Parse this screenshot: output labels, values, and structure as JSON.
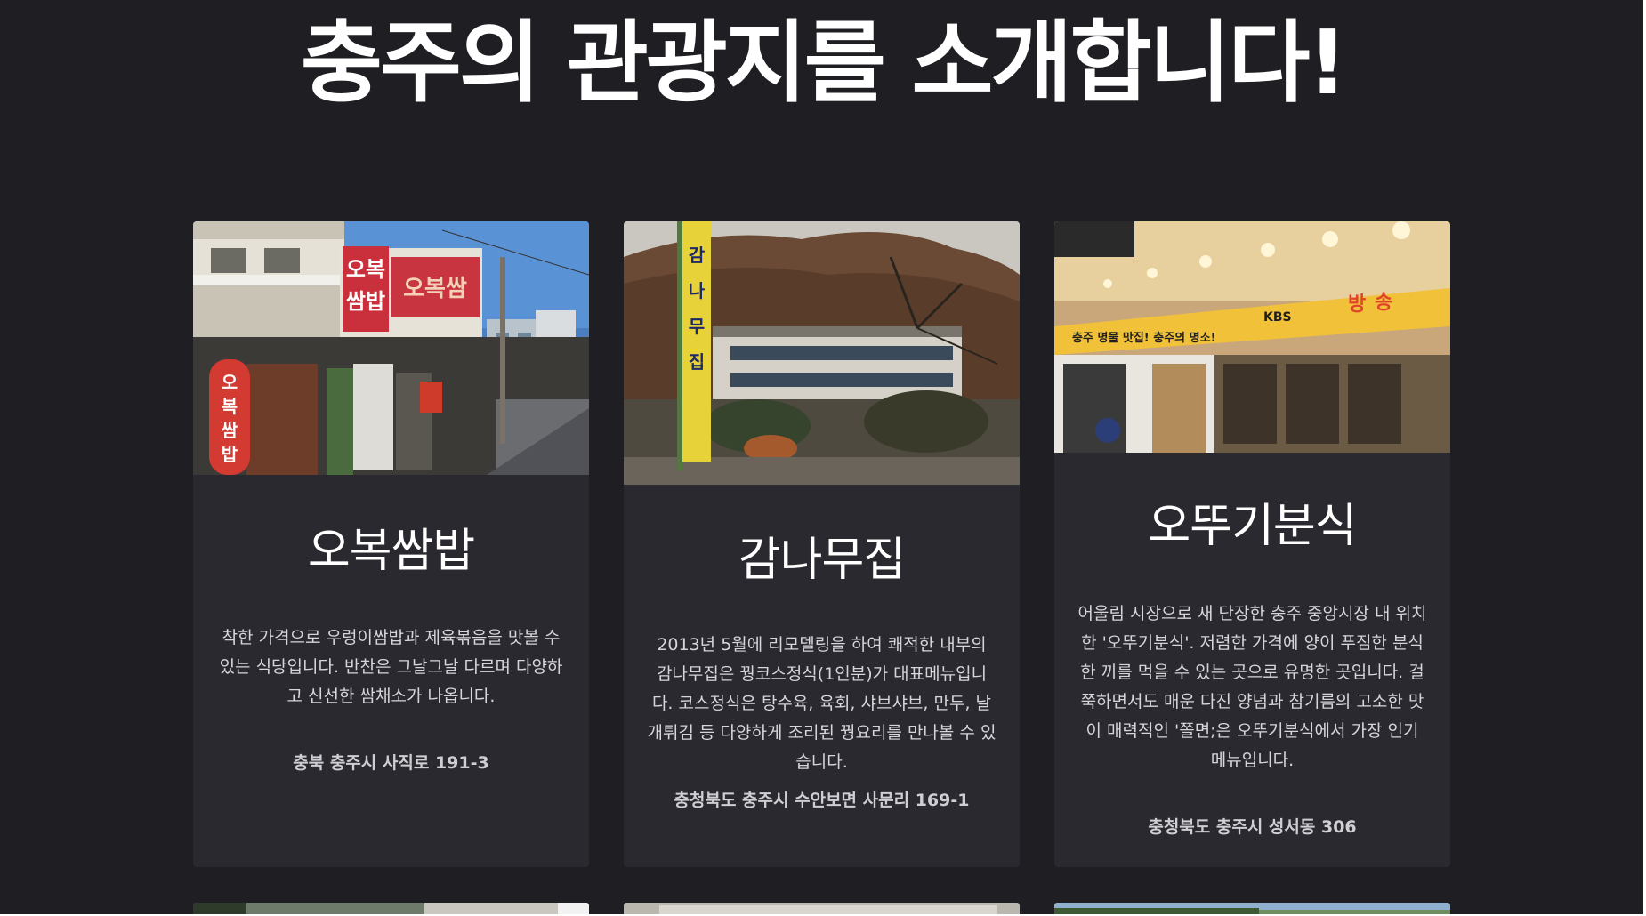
{
  "page": {
    "title": "충주의 관광지를 소개합니다!"
  },
  "cards": [
    {
      "name": "오복쌈밥",
      "description": "착한 가격으로 우렁이쌈밥과 제육볶음을 맛볼 수 있는 식당입니다. 반찬은 그날그날 다르며 다양하고 신선한 쌈채소가 나옵니다.",
      "address": "충북 충주시 사직로 191-3",
      "photo_sign": "오복쌈밥"
    },
    {
      "name": "감나무집",
      "description": "2013년 5월에 리모델링을 하여 쾌적한 내부의 감나무집은 꿩코스정식(1인분)가 대표메뉴입니다. 코스정식은 탕수육, 육회, 샤브샤브, 만두, 날개튀김 등 다양하게 조리된 꿩요리를 만나볼 수 있습니다.",
      "address": "충청북도 충주시 수안보면 사문리 169-1",
      "photo_sign": "감나무집"
    },
    {
      "name": "오뚜기분식",
      "description": "어울림 시장으로 새 단장한 충주 중앙시장 내 위치한 '오뚜기분식'. 저렴한 가격에 양이 푸짐한 분식 한 끼를 먹을 수 있는 곳으로 유명한 곳입니다. 걸쭉하면서도 매운 다진 양념과 참기름의 고소한 맛이 매력적인 '쫄면;은 오뚜기분식에서 가장 인기 메뉴입니다.",
      "address": "충청북도 충주시 성서동 306",
      "photo_sign": "충주 명물 맛집! 충주의 명소! KBS 방송"
    }
  ],
  "colors": {
    "background": "#1f1e23",
    "card": "#2a292f",
    "title": "#ffffff",
    "body_text": "#d6d6da"
  }
}
